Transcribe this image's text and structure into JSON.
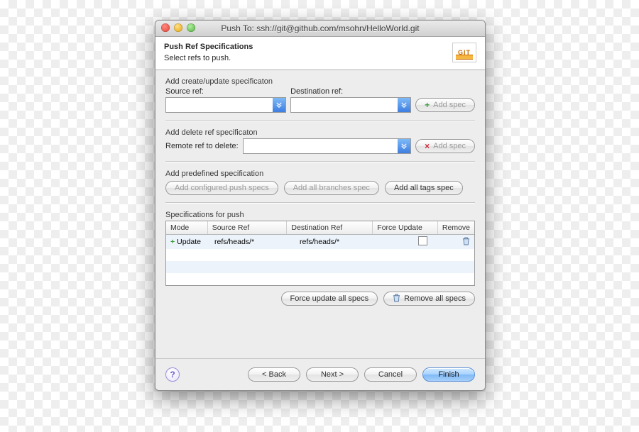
{
  "window_title": "Push To: ssh://git@github.com/msohn/HelloWorld.git",
  "header": {
    "title": "Push Ref Specifications",
    "subtitle": "Select refs to push.",
    "logo_text": "GIT"
  },
  "create_update": {
    "section_label": "Add create/update specificaton",
    "source_label": "Source ref:",
    "source_value": "",
    "dest_label": "Destination ref:",
    "dest_value": "",
    "add_button": "Add spec"
  },
  "delete_spec": {
    "section_label": "Add delete ref specificaton",
    "remote_label": "Remote ref to delete:",
    "remote_value": "",
    "add_button": "Add spec"
  },
  "predefined": {
    "section_label": "Add predefined specification",
    "configured_btn": "Add configured push specs",
    "branches_btn": "Add all branches spec",
    "tags_btn": "Add all tags spec"
  },
  "spec_table": {
    "section_label": "Specifications for push",
    "headers": {
      "mode": "Mode",
      "source": "Source Ref",
      "dest": "Destination Ref",
      "force": "Force Update",
      "remove": "Remove"
    },
    "rows": [
      {
        "mode": "Update",
        "source": "refs/heads/*",
        "dest": "refs/heads/*",
        "force": false
      }
    ],
    "force_all_btn": "Force update all specs",
    "remove_all_btn": "Remove all specs"
  },
  "footer": {
    "back": "< Back",
    "next": "Next >",
    "cancel": "Cancel",
    "finish": "Finish"
  }
}
